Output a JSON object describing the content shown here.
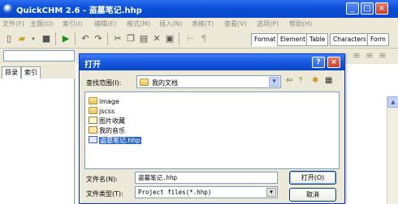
{
  "window": {
    "title": "QuickCHM 2.6 - 盗墓笔记.hhp",
    "minimize": "_",
    "maximize": "□",
    "close": "×"
  },
  "menu": [
    "文件(F)",
    "主题(O)",
    "索引(I)",
    "编辑(E)",
    "格式(M)",
    "插入(N)",
    "表格(T)",
    "查看(V)",
    "选项(P)",
    "帮助(H)"
  ],
  "toolbar": {
    "tag_tabs": [
      "Format",
      "Element",
      "Table",
      "Characters",
      "Form"
    ]
  },
  "left_pane": {
    "tabs": [
      "目录",
      "索引"
    ]
  },
  "dialog": {
    "title": "打开",
    "help": "?",
    "close": "×",
    "look_in_label": "查找范围(I):",
    "look_in_value": "我的文档",
    "files": [
      {
        "name": "image",
        "type": "folder",
        "selected": false
      },
      {
        "name": "jscss",
        "type": "folder",
        "selected": false
      },
      {
        "name": "图片收藏",
        "type": "folder",
        "selected": false
      },
      {
        "name": "我的音乐",
        "type": "music-folder",
        "selected": false
      },
      {
        "name": "盗墓笔记.hhp",
        "type": "hhp",
        "selected": true
      }
    ],
    "filename_label": "文件名(N):",
    "filename_value": "盗墓笔记.hhp",
    "filetype_label": "文件类型(T):",
    "filetype_value": "Project files(*.hhp)",
    "open_button": "打开(O)",
    "cancel_button": "取消"
  }
}
